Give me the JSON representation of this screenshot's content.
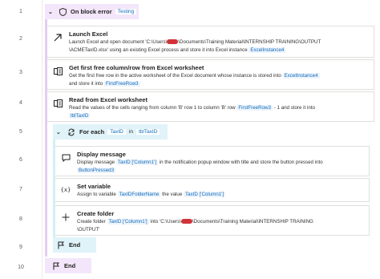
{
  "line_numbers": [
    "1",
    "2",
    "3",
    "4",
    "5",
    "6",
    "7",
    "8",
    "9",
    "10"
  ],
  "block": {
    "title": "On block error",
    "badge": "Testing"
  },
  "actions": {
    "launch_excel": {
      "title": "Launch Excel",
      "desc_1": "Launch Excel and open document 'C:\\Users\\",
      "desc_2": "\\Documents\\Training Material\\INTERNSHIP TRAINING\\OUTPUT",
      "desc_3": "\\ACMETaxID.xlsx' using an existing Excel process and store it into Excel instance",
      "var_1": "ExcelInstance4"
    },
    "get_first_free": {
      "title": "Get first free column/row from Excel worksheet",
      "desc_1": "Get the first free row in the active worksheet of the Excel document whose instance is stored into",
      "var_1": "ExcelInstance4",
      "desc_2": "and store it into",
      "var_2": "FirstFreeRow3"
    },
    "read_excel": {
      "title": "Read from Excel worksheet",
      "desc_1": "Read the values of the cells ranging from column 'B' row 1 to column 'B' row",
      "var_1": "FirstFreeRow3",
      "desc_2": "- 1 and store it into",
      "var_2": "tblTaxID"
    }
  },
  "loop": {
    "title": "For each",
    "var_1": "TaxID",
    "in_label": "in",
    "var_2": "tblTaxID"
  },
  "inner": {
    "display_message": {
      "title": "Display message",
      "desc_1": "Display message",
      "var_1": "TaxID ['Column1']",
      "desc_2": "in the notification popup window with title  and store the button pressed into",
      "var_2": "ButtonPressed3"
    },
    "set_variable": {
      "title": "Set variable",
      "desc_1": "Assign to variable",
      "var_1": "TaxIDFolderName",
      "desc_2": "the value",
      "var_2": "TaxID ['Column1']"
    },
    "create_folder": {
      "title": "Create folder",
      "desc_1": "Create folder",
      "var_1": "TaxID ['Column1']",
      "desc_2": "into 'C:\\Users\\",
      "desc_3": "\\Documents\\Training Material\\INTERNSHIP TRAINING",
      "desc_4": "\\OUTPUT'"
    }
  },
  "end_loop": "End",
  "end_block": "End",
  "icons": {
    "block": "shield-icon",
    "launch": "launch-arrow-icon",
    "excel": "excel-icon",
    "loop": "loop-icon",
    "message": "message-icon",
    "variable": "variable-icon",
    "folder": "plus-icon",
    "end": "flag-icon"
  },
  "colors": {
    "block_header": "#f3e6fa",
    "loop_header": "#dff3f9",
    "variable": "#0f6cbd",
    "redaction": "#d13438"
  }
}
